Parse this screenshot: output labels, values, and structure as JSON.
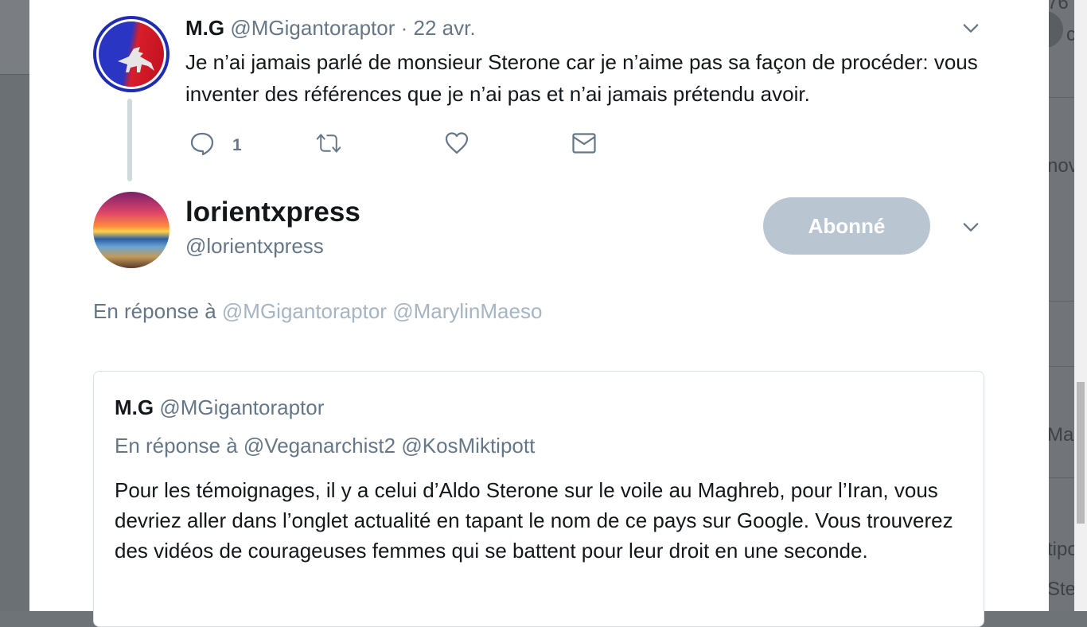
{
  "background": {
    "right_snippets": [
      "76",
      "c",
      "nov",
      "Ma",
      "tipo",
      "Ste"
    ]
  },
  "tweet": {
    "name": "M.G",
    "handle": "@MGigantoraptor",
    "sep": "·",
    "date": "22 avr.",
    "text": "Je n’ai jamais parlé de monsieur Sterone car je n’aime pas sa façon de procéder: vous inventer des références que je n’ai pas et n’ai jamais prétendu avoir.",
    "reply_count": "1",
    "icons": {
      "reply": "speech-bubble-icon",
      "retweet": "retweet-icon",
      "like": "heart-icon",
      "dm": "envelope-icon",
      "more": "chevron-down-icon"
    }
  },
  "focused": {
    "name": "lorientxpress",
    "handle": "@lorientxpress",
    "follow_label": "Abonné",
    "reply_prefix": "En réponse à",
    "reply_mentions": [
      "@MGigantoraptor",
      "@MarylinMaeso"
    ]
  },
  "quote": {
    "name": "M.G",
    "handle": "@MGigantoraptor",
    "reply_prefix": "En réponse à",
    "reply_mentions": [
      "@Veganarchist2",
      "@KosMiktipott"
    ],
    "text": "Pour les témoignages, il y a celui d’Aldo Sterone sur le voile au Maghreb, pour l’Iran, vous devriez aller dans l’onglet actualité en tapant le nom de ce pays sur Google. Vous trouverez des vidéos de courageuses femmes qui se battent pour leur droit en une seconde."
  },
  "colors": {
    "primary_text": "#14171a",
    "secondary_text": "#657786",
    "follow_button": "#b9c6d1",
    "mention_muted": "#a6b5c2"
  }
}
